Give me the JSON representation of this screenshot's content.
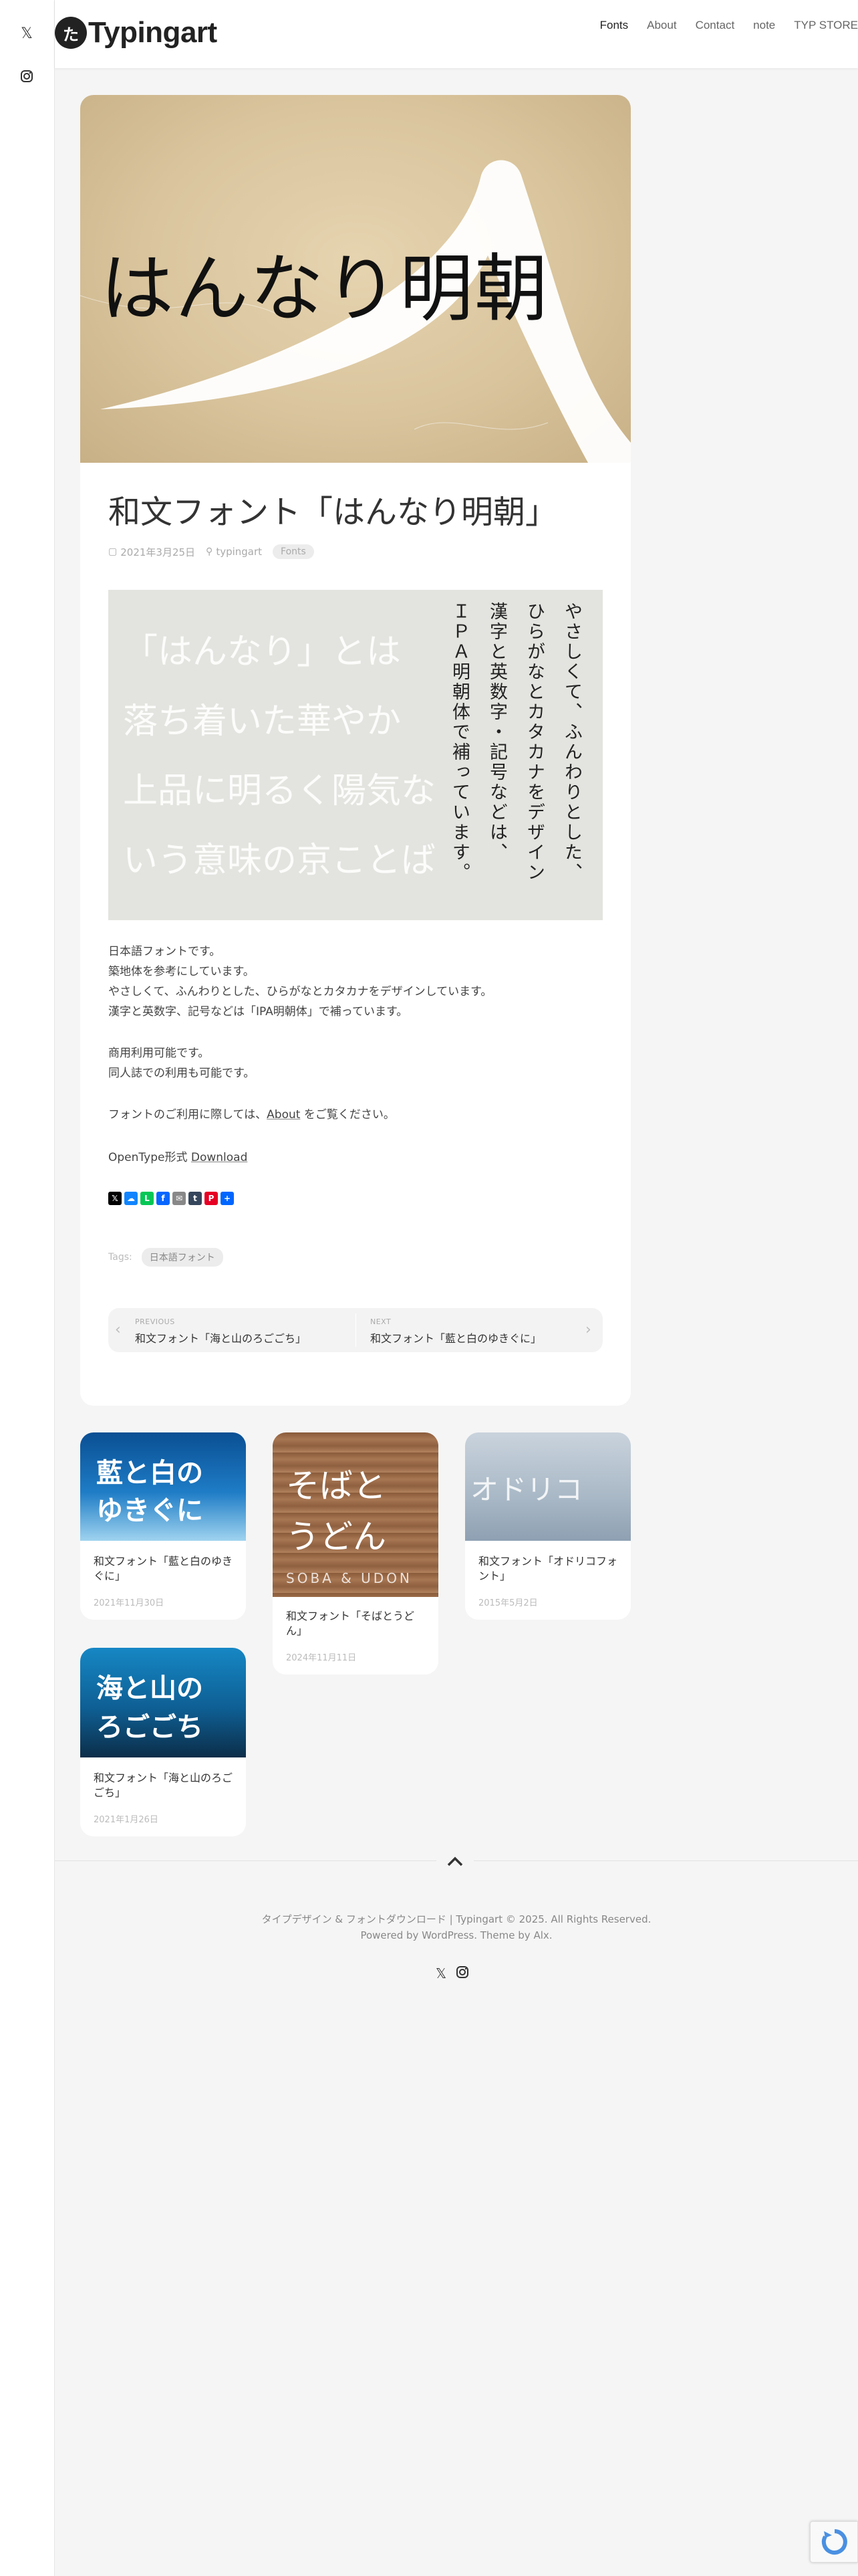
{
  "site": {
    "logo_mark": "た",
    "name": "Typingart"
  },
  "nav": [
    "Fonts",
    "About",
    "Contact",
    "note",
    "TYP STORE"
  ],
  "left_social": [
    "x-icon",
    "instagram-icon"
  ],
  "post": {
    "hero_text": "はんなり明朝",
    "title": "和文フォント「はんなり明朝」",
    "date": "2021年3月25日",
    "author": "typingart",
    "category": "Fonts",
    "sample_lines": [
      "「はんなり」とは",
      "落ち着いた華やか",
      "上品に明るく陽気な",
      "いう意味の京ことば"
    ],
    "sample_vertical": [
      "やさしくて、ふんわりとした、",
      "ひらがなとカタカナをデザイン",
      "漢字と英数字・記号などは、",
      "ＩＰＡ明朝体で補っています。"
    ],
    "paragraph1": [
      "日本語フォントです。",
      "築地体を参考にしています。",
      "やさしくて、ふんわりとした、ひらがなとカタカナをデザインしています。",
      "漢字と英数字、記号などは「IPA明朝体」で補っています。"
    ],
    "paragraph2": [
      "商用利用可能です。",
      "同人誌での利用も可能です。"
    ],
    "usage_prefix": "フォントのご利用に際しては、",
    "usage_link": "About",
    "usage_suffix": " をご覧ください。",
    "format_text": "OpenType形式 ",
    "download_link": "Download",
    "tags_label": "Tags:",
    "tag": "日本語フォント"
  },
  "pager": {
    "prev_label": "PREVIOUS",
    "prev_title": "和文フォント「海と山のろごごち」",
    "next_label": "NEXT",
    "next_title": "和文フォント「藍と白のゆきぐに」"
  },
  "related": [
    {
      "img_text_1": "藍と白の",
      "img_text_2": "ゆきぐに",
      "title": "和文フォント「藍と白のゆきぐに」",
      "date": "2021年11月30日"
    },
    {
      "img_text_1": "そばと",
      "img_text_2": "うどん",
      "img_text_3": "SOBA & UDON",
      "title": "和文フォント「そばとうどん」",
      "date": "2024年11月11日"
    },
    {
      "img_text_1": "オドリコ",
      "title": "和文フォント「オドリコフォント」",
      "date": "2015年5月2日"
    },
    {
      "img_text_1": "海と山の",
      "img_text_2": "ろごごち",
      "title": "和文フォント「海と山のろごごち」",
      "date": "2021年1月26日"
    }
  ],
  "footer": {
    "line1": "タイプデザイン & フォントダウンロード | Typingart © 2025. All Rights Reserved.",
    "line2_prefix": "Powered by ",
    "line2_wp": "WordPress",
    "line2_mid": ". Theme by ",
    "line2_alx": "Alx",
    "line2_end": "."
  },
  "colors": {
    "accent": "#333333",
    "hero_paper": "#dcc8a2",
    "sample_bg": "#e3e4df"
  }
}
